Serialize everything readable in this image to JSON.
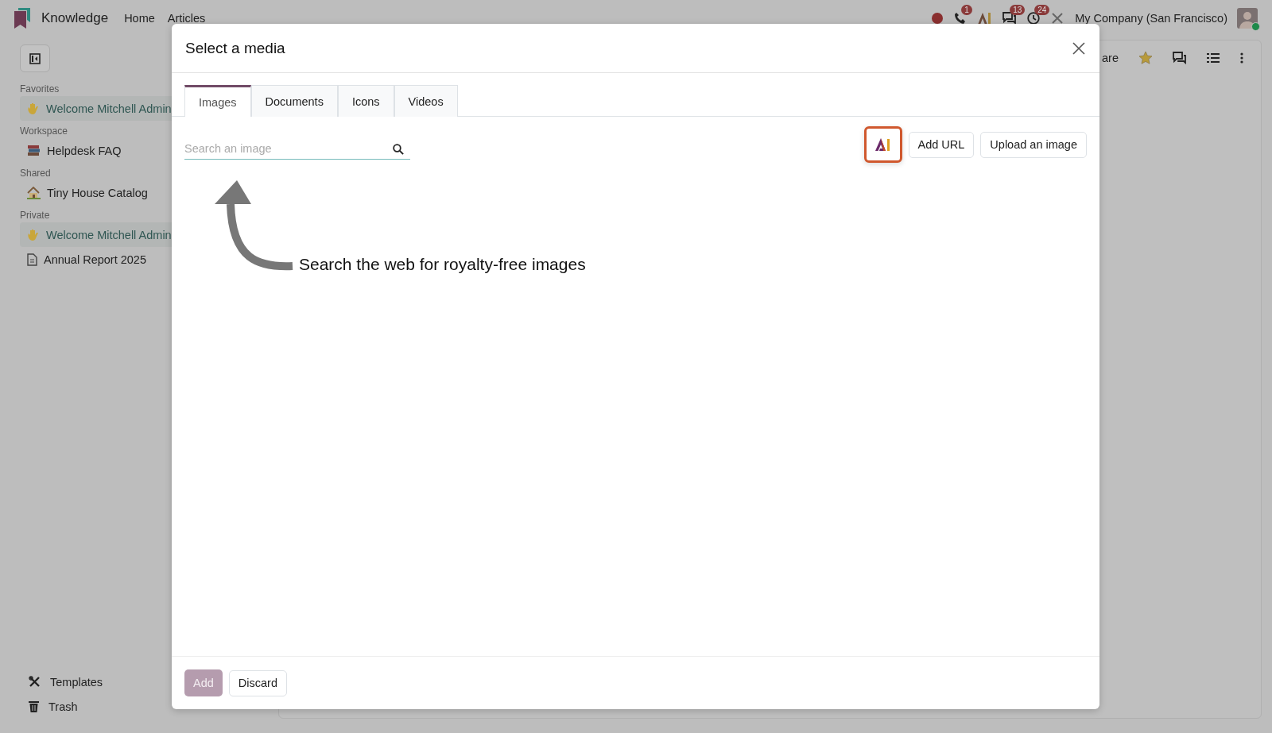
{
  "topbar": {
    "app_name": "Knowledge",
    "nav": [
      "Home",
      "Articles"
    ],
    "phone_badge": "1",
    "chat_badge": "13",
    "activity_badge": "24",
    "company": "My Company (San Francisco)"
  },
  "sidebar": {
    "sections": [
      {
        "title": "Favorites",
        "items": [
          {
            "kind": "hand",
            "label": "Welcome Mitchell Admin",
            "selected": true
          }
        ]
      },
      {
        "title": "Workspace",
        "items": [
          {
            "kind": "books",
            "label": "Helpdesk FAQ",
            "selected": false
          }
        ]
      },
      {
        "title": "Shared",
        "items": [
          {
            "kind": "house",
            "label": "Tiny House Catalog",
            "selected": false
          }
        ]
      },
      {
        "title": "Private",
        "items": [
          {
            "kind": "hand",
            "label": "Welcome Mitchell Admin",
            "selected": true
          },
          {
            "kind": "document",
            "label": "Annual Report 2025",
            "selected": false
          }
        ]
      }
    ],
    "bottom": [
      {
        "kind": "templates",
        "label": "Templates"
      },
      {
        "kind": "trash",
        "label": "Trash"
      }
    ]
  },
  "article": {
    "share_label": "are",
    "favorite": true
  },
  "dialog": {
    "title": "Select a media",
    "tabs": [
      {
        "label": "Images",
        "selected": true
      },
      {
        "label": "Documents",
        "selected": false
      },
      {
        "label": "Icons",
        "selected": false
      },
      {
        "label": "Videos",
        "selected": false
      }
    ],
    "search": {
      "placeholder": "Search an image"
    },
    "ai_button": {
      "highlighted": true
    },
    "buttons": [
      "Add URL",
      "Upload an image"
    ],
    "hint": "Search the web for royalty-free images",
    "footer": {
      "add": {
        "label": "Add",
        "disabled": true
      },
      "discard": "Discard"
    }
  }
}
